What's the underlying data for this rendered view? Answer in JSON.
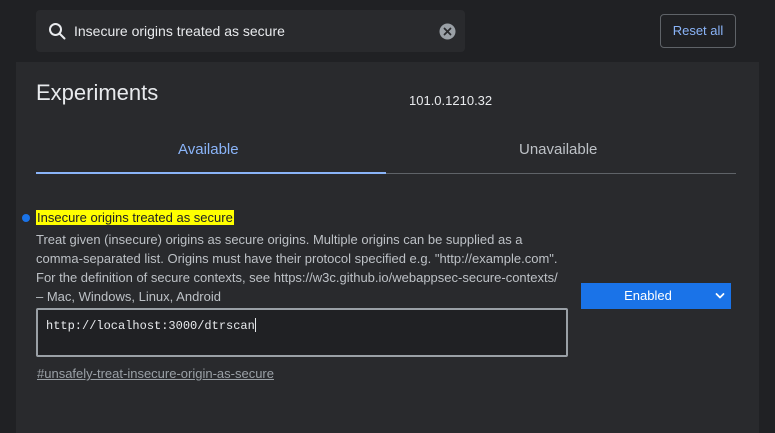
{
  "search": {
    "value": "Insecure origins treated as secure",
    "icon": "search-icon",
    "clear_icon": "clear-icon"
  },
  "toolbar": {
    "reset_label": "Reset all"
  },
  "page": {
    "title": "Experiments",
    "version": "101.0.1210.32"
  },
  "tabs": [
    {
      "label": "Available",
      "active": true
    },
    {
      "label": "Unavailable",
      "active": false
    }
  ],
  "experiment": {
    "title": "Insecure origins treated as secure",
    "description_lines": [
      "Treat given (insecure) origins as secure origins. Multiple origins can be supplied as a",
      "comma-separated list. Origins must have their protocol specified e.g. \"http://example.com\".",
      "For the definition of secure contexts, see https://w3c.github.io/webappsec-secure-contexts/",
      "– Mac, Windows, Linux, Android"
    ],
    "input_value": "http://localhost:3000/dtrscan",
    "flag_link": "#unsafely-treat-insecure-origin-as-secure",
    "state": "Enabled"
  },
  "colors": {
    "accent": "#8ab4f8",
    "button_blue": "#1a73e8",
    "highlight": "#ffff00",
    "background": "#292a2d",
    "header_background": "#202124"
  }
}
